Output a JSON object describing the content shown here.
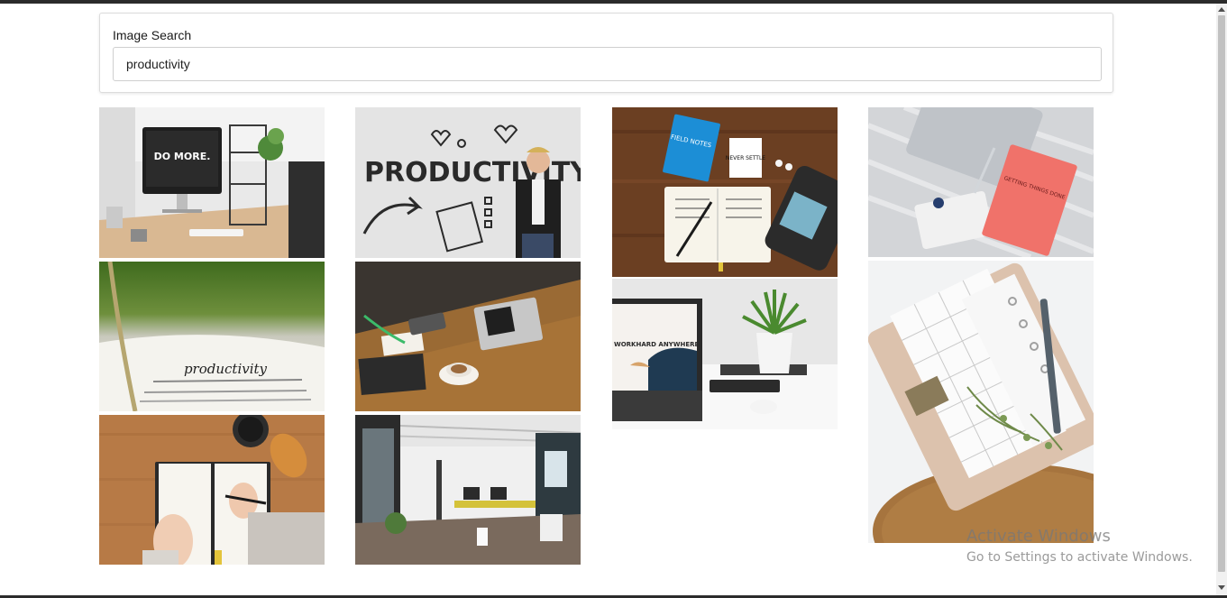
{
  "search": {
    "label": "Image Search",
    "value": "productivity"
  },
  "images": [
    {
      "subject": "desktop computer on wooden desk",
      "screen_text": "DO MORE."
    },
    {
      "subject": "open book page",
      "book_text": "productivity"
    },
    {
      "subject": "hands writing in notebook with coffee and croissant"
    },
    {
      "subject": "man on phone in front of whiteboard",
      "wall_text": "PRODUCTIVITY"
    },
    {
      "subject": "people working at cafe table with laptop"
    },
    {
      "subject": "open plan office interior"
    },
    {
      "subject": "notebooks and laptop on wooden table",
      "notebook_text": "FIELD NOTES",
      "card_text": "NEVER SETTLE"
    },
    {
      "subject": "laptop and plant on white desk",
      "screen_text": "WORKHARD ANYWHERE"
    },
    {
      "subject": "laptop, envelope and red book on bedsheet",
      "book_text": "GETTING THINGS DONE"
    },
    {
      "subject": "planner binder with pen and plant on cork board"
    }
  ],
  "watermark": {
    "title": "Activate Windows",
    "subtitle": "Go to Settings to activate Windows."
  }
}
